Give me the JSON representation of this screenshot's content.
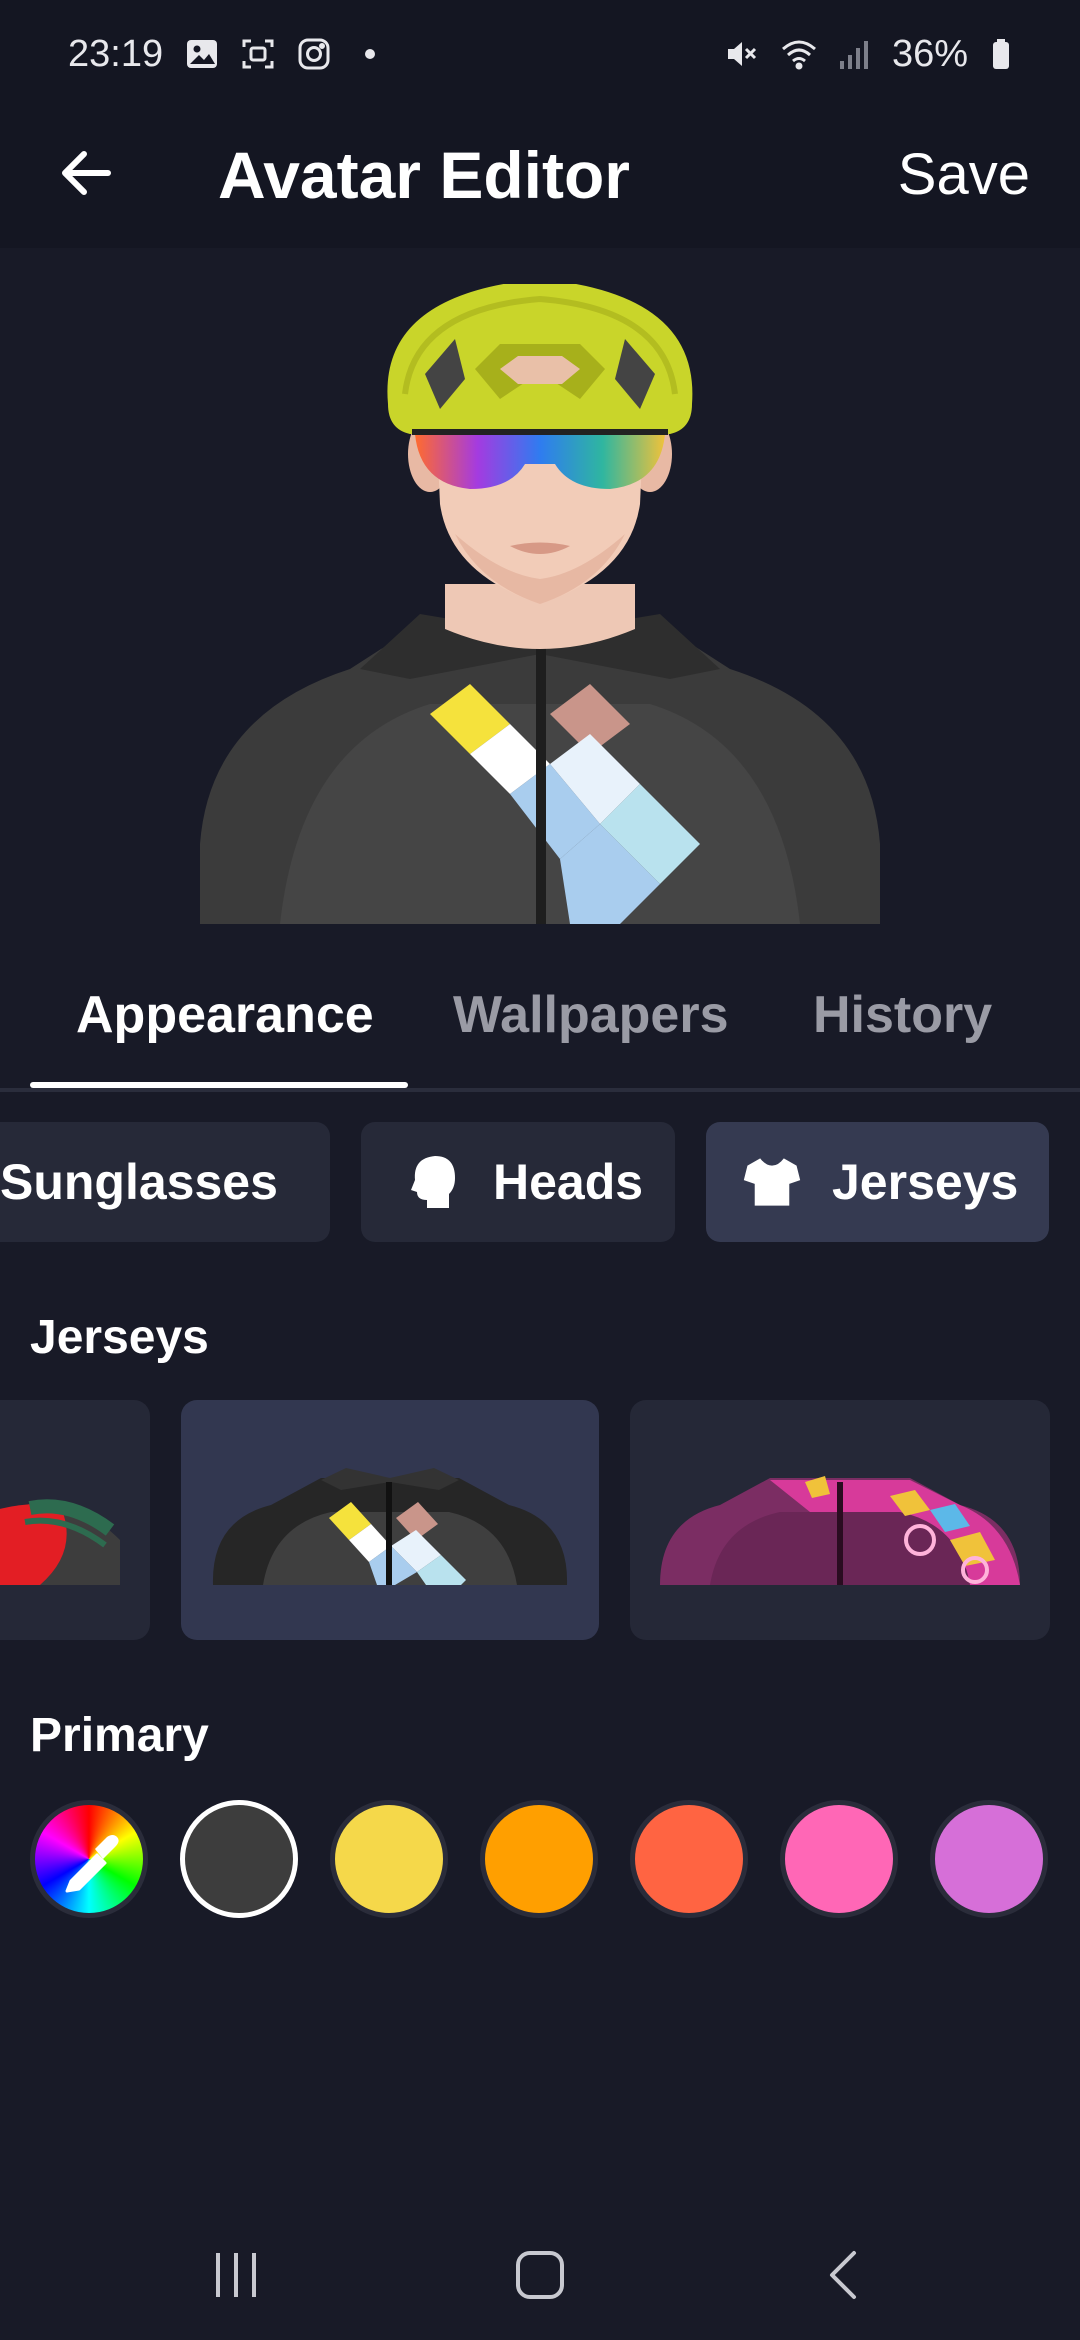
{
  "status_bar": {
    "time": "23:19",
    "battery": "36%",
    "left_icons": [
      "gallery-icon",
      "screenshot-icon",
      "instagram-icon",
      "dot-icon"
    ],
    "right_icons": [
      "mute-icon",
      "wifi-icon",
      "signal-icon",
      "battery-icon"
    ]
  },
  "header": {
    "title": "Avatar Editor",
    "save_label": "Save"
  },
  "tabs": [
    {
      "label": "Appearance",
      "active": true
    },
    {
      "label": "Wallpapers",
      "active": false
    },
    {
      "label": "History",
      "active": false
    }
  ],
  "categories": [
    {
      "label": "Sunglasses",
      "icon": "sunglasses-icon",
      "selected": false
    },
    {
      "label": "Heads",
      "icon": "head-icon",
      "selected": false
    },
    {
      "label": "Jerseys",
      "icon": "tshirt-icon",
      "selected": true
    }
  ],
  "jerseys": {
    "title": "Jerseys",
    "options": [
      {
        "name": "red-green-jersey",
        "selected": false
      },
      {
        "name": "argyle-jersey",
        "selected": true
      },
      {
        "name": "purple-pattern-jersey",
        "selected": false
      }
    ]
  },
  "primary": {
    "title": "Primary",
    "swatches": [
      {
        "name": "color-picker",
        "color": "rainbow",
        "selected": false
      },
      {
        "name": "dark-gray",
        "color": "#3d3d3d",
        "selected": true
      },
      {
        "name": "yellow",
        "color": "#f5d84a",
        "selected": false
      },
      {
        "name": "orange",
        "color": "#ff9f00",
        "selected": false
      },
      {
        "name": "red-orange",
        "color": "#ff6442",
        "selected": false
      },
      {
        "name": "pink",
        "color": "#ff67b6",
        "selected": false
      },
      {
        "name": "violet",
        "color": "#d66fd8",
        "selected": false
      }
    ]
  },
  "colors": {
    "background": "#181a27",
    "header": "#141622",
    "chip": "#262938",
    "chip_selected": "#353a51",
    "tab_inactive": "#9a9ba5"
  }
}
